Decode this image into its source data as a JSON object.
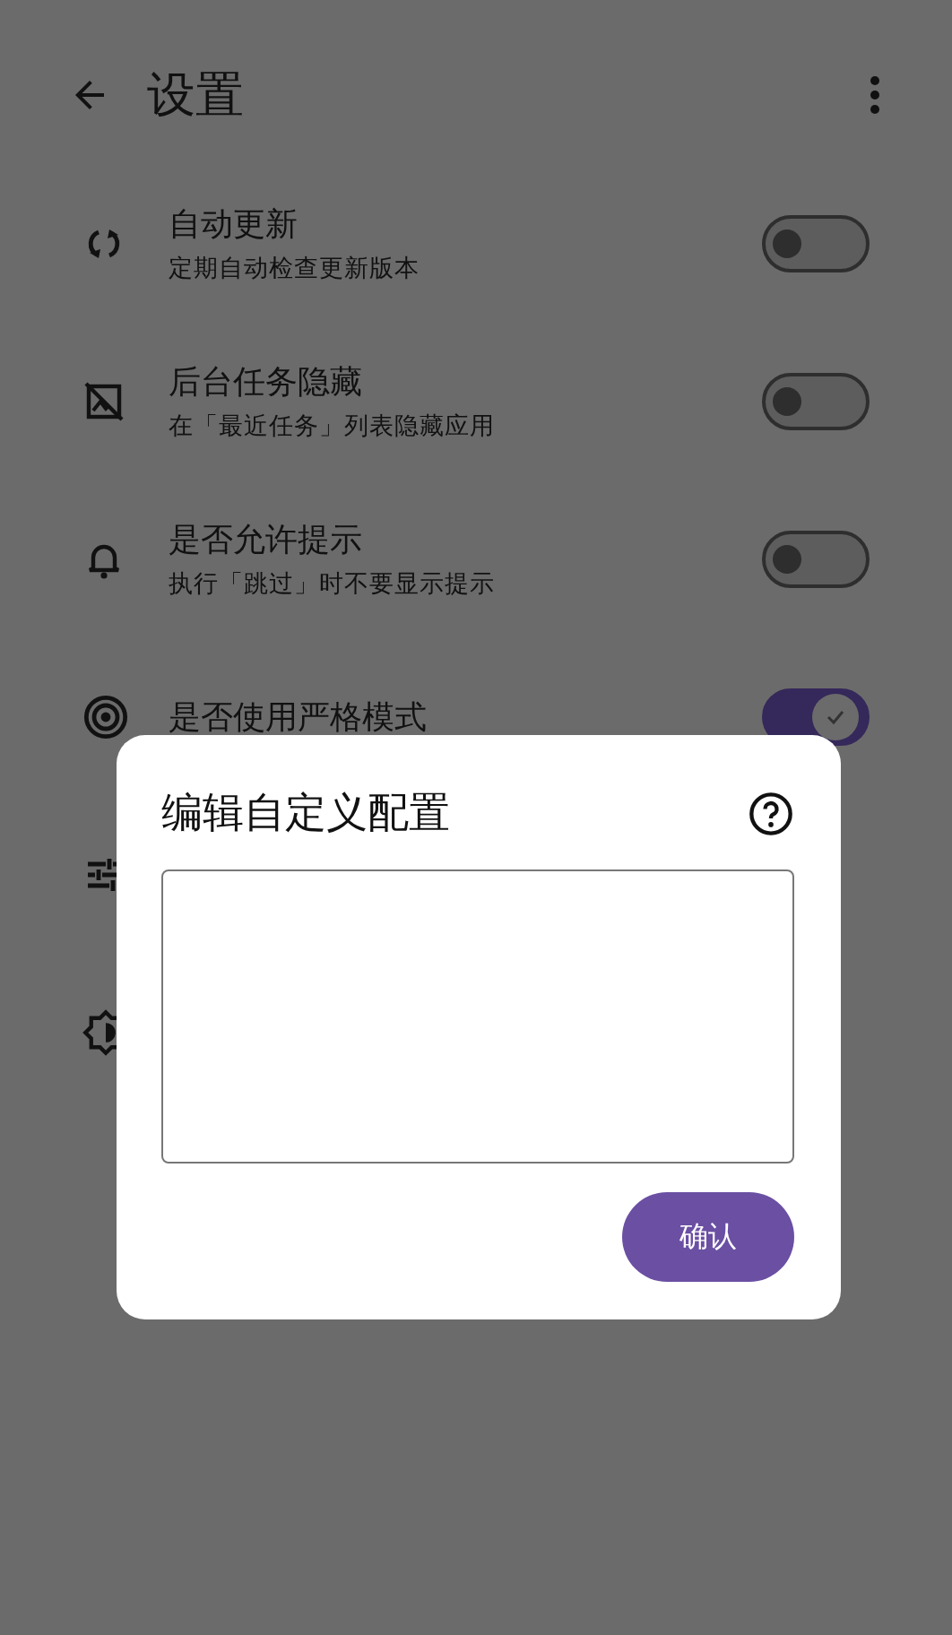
{
  "header": {
    "title": "设置"
  },
  "settings": [
    {
      "title": "自动更新",
      "subtitle": "定期自动检查更新版本",
      "on": false
    },
    {
      "title": "后台任务隐藏",
      "subtitle": "在「最近任务」列表隐藏应用",
      "on": false
    },
    {
      "title": "是否允许提示",
      "subtitle": "执行「跳过」时不要显示提示",
      "on": false
    },
    {
      "title": "是否使用严格模式",
      "on": true
    }
  ],
  "dialog": {
    "title": "编辑自定义配置",
    "button": "确认"
  }
}
